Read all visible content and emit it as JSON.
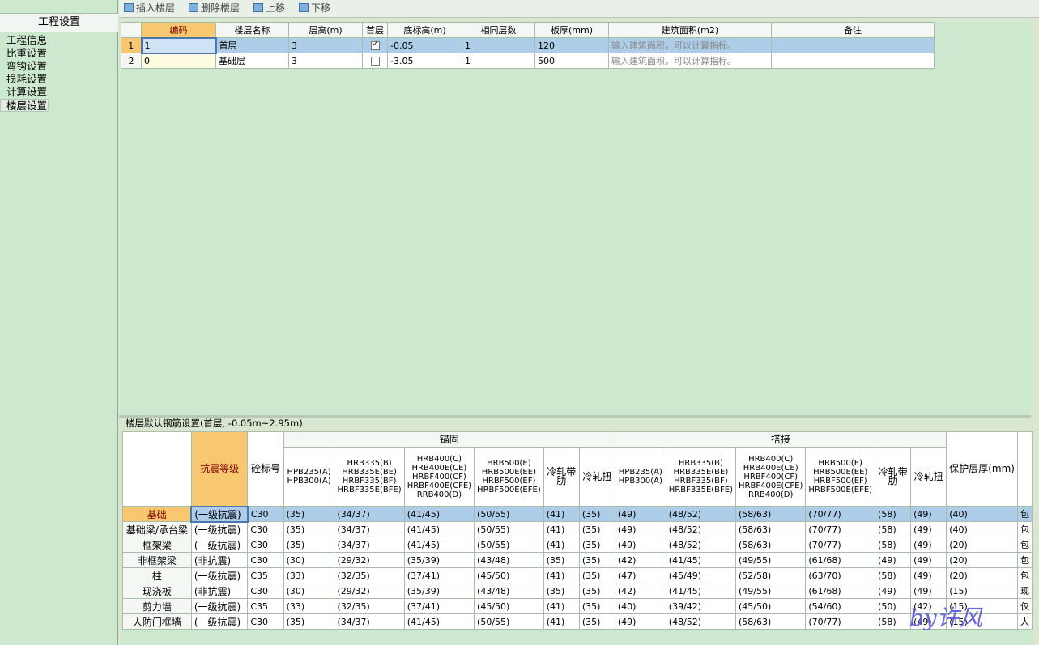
{
  "left_panel": {
    "title": "工程设置",
    "items": [
      "工程信息",
      "比重设置",
      "弯钩设置",
      "损耗设置",
      "计算设置",
      "楼层设置"
    ],
    "active_index": 5
  },
  "toolbar": {
    "insert_floor": "插入楼层",
    "delete_floor": "删除楼层",
    "move_up": "上移",
    "move_down": "下移"
  },
  "floor_table": {
    "columns": [
      "",
      "编码",
      "楼层名称",
      "层高(m)",
      "首层",
      "底标高(m)",
      "相同层数",
      "板厚(mm)",
      "建筑面积(m2)",
      "备注"
    ],
    "rows": [
      {
        "num": "1",
        "code": "1",
        "name": "首层",
        "height": "3",
        "first": true,
        "bottom": "-0.05",
        "same": "1",
        "thickness": "120",
        "area": "输入建筑面积，可以计算指标。",
        "note": ""
      },
      {
        "num": "2",
        "code": "0",
        "name": "基础层",
        "height": "3",
        "first": false,
        "bottom": "-3.05",
        "same": "1",
        "thickness": "500",
        "area": "输入建筑面积，可以计算指标。",
        "note": ""
      }
    ]
  },
  "rebar_settings": {
    "title": "楼层默认钢筋设置(首层, -0.05m~2.95m)",
    "group_anchor": "锚固",
    "group_lap": "搭接",
    "col_seismic": "抗震等级",
    "col_concrete": "砼标号",
    "col_cover": "保护层厚(mm)",
    "sub_cols": [
      "HPB235(A)\nHPB300(A)",
      "HRB335(B)\nHRB335E(BE)\nHRBF335(BF)\nHRBF335E(BFE)",
      "HRB400(C)\nHRB400E(CE)\nHRBF400(CF)\nHRBF400E(CFE)\nRRB400(D)",
      "HRB500(E)\nHRB500E(EE)\nHRBF500(EF)\nHRBF500E(EFE)",
      "冷轧带肋",
      "冷轧扭"
    ],
    "rows": [
      {
        "name": "基础",
        "seismic": "(一级抗震)",
        "concrete": "C30",
        "anchor": [
          "(35)",
          "(34/37)",
          "(41/45)",
          "(50/55)",
          "(41)",
          "(35)"
        ],
        "lap": [
          "(49)",
          "(48/52)",
          "(58/63)",
          "(70/77)",
          "(58)",
          "(49)"
        ],
        "cover": "(40)",
        "extra": "包"
      },
      {
        "name": "基础梁/承台梁",
        "seismic": "(一级抗震)",
        "concrete": "C30",
        "anchor": [
          "(35)",
          "(34/37)",
          "(41/45)",
          "(50/55)",
          "(41)",
          "(35)"
        ],
        "lap": [
          "(49)",
          "(48/52)",
          "(58/63)",
          "(70/77)",
          "(58)",
          "(49)"
        ],
        "cover": "(40)",
        "extra": "包"
      },
      {
        "name": "框架梁",
        "seismic": "(一级抗震)",
        "concrete": "C30",
        "anchor": [
          "(35)",
          "(34/37)",
          "(41/45)",
          "(50/55)",
          "(41)",
          "(35)"
        ],
        "lap": [
          "(49)",
          "(48/52)",
          "(58/63)",
          "(70/77)",
          "(58)",
          "(49)"
        ],
        "cover": "(20)",
        "extra": "包"
      },
      {
        "name": "非框架梁",
        "seismic": "(非抗震)",
        "concrete": "C30",
        "anchor": [
          "(30)",
          "(29/32)",
          "(35/39)",
          "(43/48)",
          "(35)",
          "(35)"
        ],
        "lap": [
          "(42)",
          "(41/45)",
          "(49/55)",
          "(61/68)",
          "(49)",
          "(49)"
        ],
        "cover": "(20)",
        "extra": "包"
      },
      {
        "name": "柱",
        "seismic": "(一级抗震)",
        "concrete": "C35",
        "anchor": [
          "(33)",
          "(32/35)",
          "(37/41)",
          "(45/50)",
          "(41)",
          "(35)"
        ],
        "lap": [
          "(47)",
          "(45/49)",
          "(52/58)",
          "(63/70)",
          "(58)",
          "(49)"
        ],
        "cover": "(20)",
        "extra": "包"
      },
      {
        "name": "现浇板",
        "seismic": "(非抗震)",
        "concrete": "C30",
        "anchor": [
          "(30)",
          "(29/32)",
          "(35/39)",
          "(43/48)",
          "(35)",
          "(35)"
        ],
        "lap": [
          "(42)",
          "(41/45)",
          "(49/55)",
          "(61/68)",
          "(49)",
          "(49)"
        ],
        "cover": "(15)",
        "extra": "现"
      },
      {
        "name": "剪力墙",
        "seismic": "(一级抗震)",
        "concrete": "C35",
        "anchor": [
          "(33)",
          "(32/35)",
          "(37/41)",
          "(45/50)",
          "(41)",
          "(35)"
        ],
        "lap": [
          "(40)",
          "(39/42)",
          "(45/50)",
          "(54/60)",
          "(50)",
          "(42)"
        ],
        "cover": "(15)",
        "extra": "仅"
      },
      {
        "name": "人防门框墙",
        "seismic": "(一级抗震)",
        "concrete": "C30",
        "anchor": [
          "(35)",
          "(34/37)",
          "(41/45)",
          "(50/55)",
          "(41)",
          "(35)"
        ],
        "lap": [
          "(49)",
          "(48/52)",
          "(58/63)",
          "(70/77)",
          "(58)",
          "(49)"
        ],
        "cover": "(15)",
        "extra": "人"
      }
    ]
  },
  "watermark": "by许风"
}
